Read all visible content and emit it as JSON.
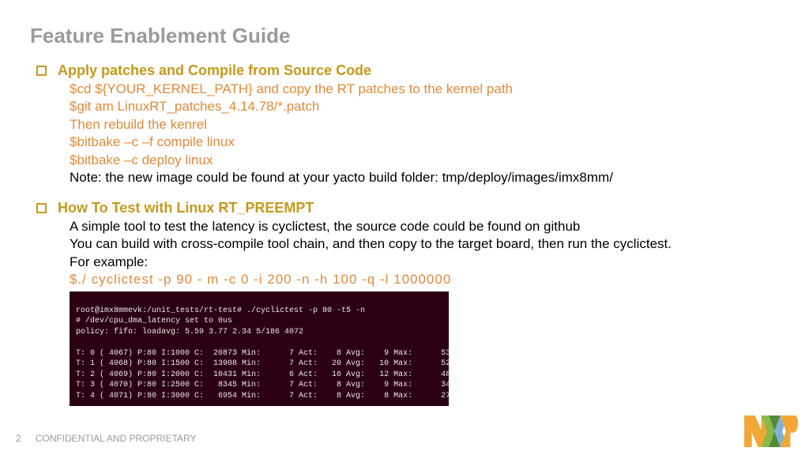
{
  "title": "Feature Enablement Guide",
  "sections": [
    {
      "heading": "Apply patches and Compile from Source Code",
      "lines": [
        {
          "kind": "cmd",
          "text": "$cd ${YOUR_KERNEL_PATH} and copy the RT patches to the kernel path"
        },
        {
          "kind": "cmd",
          "text": "$git am  LinuxRT_patches_4.14.78/*.patch"
        },
        {
          "kind": "cmd",
          "text": "Then rebuild the kenrel"
        },
        {
          "kind": "cmd",
          "text": "$bitbake –c –f compile linux"
        },
        {
          "kind": "cmd",
          "text": "$bitbake –c deploy linux"
        },
        {
          "kind": "txt",
          "text": "Note: the new image could be found at your yacto build folder: tmp/deploy/images/imx8mm/"
        }
      ]
    },
    {
      "heading": "How To Test with Linux RT_PREEMPT",
      "lines": [
        {
          "kind": "txt",
          "text": "A simple tool to test the latency is cyclictest, the source code could be found on github"
        },
        {
          "kind": "txt",
          "text": "You can build with cross-compile tool chain, and then copy to the target board, then run the cyclictest."
        },
        {
          "kind": "txt",
          "text": "For example:"
        },
        {
          "kind": "cmdline",
          "text": "$./  cyclictest  -p  90  -  m  -c  0  -i  200  -n  -h  100  -q  -l  1000000"
        }
      ]
    }
  ],
  "terminal": {
    "lines": [
      "root@imx8mmevk:/unit_tests/rt-test# ./cyclictest -p 80 -t5 -n",
      "# /dev/cpu_dma_latency set to 0us",
      "policy: fifo: loadavg: 5.59 3.77 2.34 5/186 4072",
      "",
      "T: 0 ( 4067) P:80 I:1000 C:  20873 Min:      7 Act:    8 Avg:    9 Max:      53",
      "T: 1 ( 4068) P:80 I:1500 C:  13908 Min:      7 Act:   20 Avg:   10 Max:      52",
      "T: 2 ( 4069) P:80 I:2000 C:  10431 Min:      6 Act:   16 Avg:   12 Max:      48",
      "T: 3 ( 4070) P:80 I:2500 C:   8345 Min:      7 Act:    8 Avg:    9 Max:      34",
      "T: 4 ( 4071) P:80 I:3000 C:   6954 Min:      7 Act:    8 Avg:    8 Max:      27"
    ]
  },
  "footer": {
    "page": "2",
    "label": "CONFIDENTIAL AND PROPRIETARY"
  }
}
